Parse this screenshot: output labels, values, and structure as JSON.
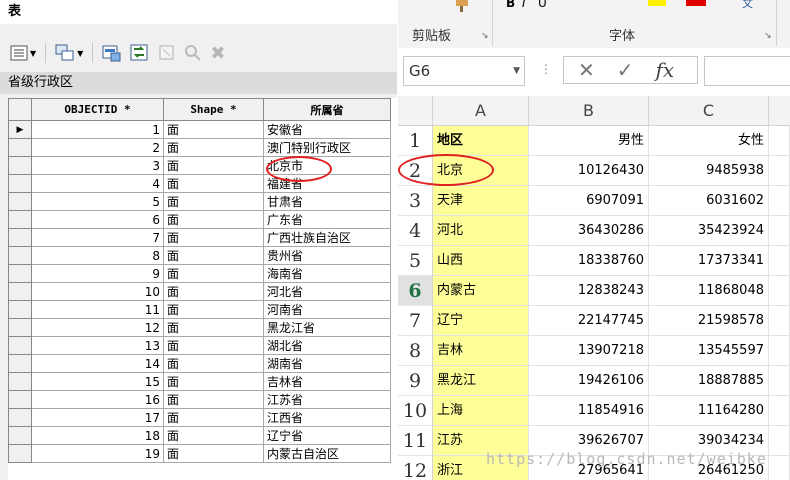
{
  "arcgis": {
    "title": "表",
    "table_name": "省级行政区",
    "columns": [
      "OBJECTID *",
      "Shape *",
      "所属省"
    ],
    "rows": [
      {
        "oid": "1",
        "shape": "面",
        "prov": "安徽省"
      },
      {
        "oid": "2",
        "shape": "面",
        "prov": "澳门特别行政区"
      },
      {
        "oid": "3",
        "shape": "面",
        "prov": "北京市"
      },
      {
        "oid": "4",
        "shape": "面",
        "prov": "福建省"
      },
      {
        "oid": "5",
        "shape": "面",
        "prov": "甘肃省"
      },
      {
        "oid": "6",
        "shape": "面",
        "prov": "广东省"
      },
      {
        "oid": "7",
        "shape": "面",
        "prov": "广西壮族自治区"
      },
      {
        "oid": "8",
        "shape": "面",
        "prov": "贵州省"
      },
      {
        "oid": "9",
        "shape": "面",
        "prov": "海南省"
      },
      {
        "oid": "10",
        "shape": "面",
        "prov": "河北省"
      },
      {
        "oid": "11",
        "shape": "面",
        "prov": "河南省"
      },
      {
        "oid": "12",
        "shape": "面",
        "prov": "黑龙江省"
      },
      {
        "oid": "13",
        "shape": "面",
        "prov": "湖北省"
      },
      {
        "oid": "14",
        "shape": "面",
        "prov": "湖南省"
      },
      {
        "oid": "15",
        "shape": "面",
        "prov": "吉林省"
      },
      {
        "oid": "16",
        "shape": "面",
        "prov": "江苏省"
      },
      {
        "oid": "17",
        "shape": "面",
        "prov": "江西省"
      },
      {
        "oid": "18",
        "shape": "面",
        "prov": "辽宁省"
      },
      {
        "oid": "19",
        "shape": "面",
        "prov": "内蒙古自治区"
      }
    ],
    "current_row_marker": "▶"
  },
  "excel": {
    "ribbon": {
      "clipboard_label": "剪贴板",
      "font_label": "字体"
    },
    "name_box": "G6",
    "formula_icons": {
      "cancel": "✕",
      "enter": "✓",
      "fx": "fx"
    },
    "columns": [
      "A",
      "B",
      "C"
    ],
    "active_row": "6",
    "rows": [
      {
        "n": "1",
        "a": "地区",
        "b": "男性",
        "c": "女性"
      },
      {
        "n": "2",
        "a": "北京",
        "b": "10126430",
        "c": "9485938"
      },
      {
        "n": "3",
        "a": "天津",
        "b": "6907091",
        "c": "6031602"
      },
      {
        "n": "4",
        "a": "河北",
        "b": "36430286",
        "c": "35423924"
      },
      {
        "n": "5",
        "a": "山西",
        "b": "18338760",
        "c": "17373341"
      },
      {
        "n": "6",
        "a": "内蒙古",
        "b": "12838243",
        "c": "11868048"
      },
      {
        "n": "7",
        "a": "辽宁",
        "b": "22147745",
        "c": "21598578"
      },
      {
        "n": "8",
        "a": "吉林",
        "b": "13907218",
        "c": "13545597"
      },
      {
        "n": "9",
        "a": "黑龙江",
        "b": "19426106",
        "c": "18887885"
      },
      {
        "n": "10",
        "a": "上海",
        "b": "11854916",
        "c": "11164280"
      },
      {
        "n": "11",
        "a": "江苏",
        "b": "39626707",
        "c": "39034234"
      },
      {
        "n": "12",
        "a": "浙江",
        "b": "27965641",
        "c": "26461250"
      }
    ]
  },
  "watermark": "https://blog.csdn.net/weibke"
}
